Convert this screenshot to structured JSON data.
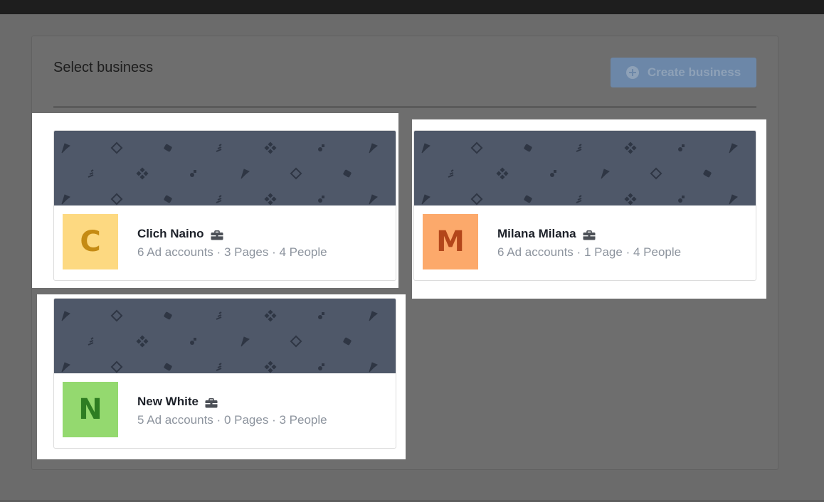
{
  "panel": {
    "title": "Select business",
    "create_button_label": "Create business"
  },
  "colors": {
    "banner": "#4f5869",
    "create_button": "#6c87a8"
  },
  "businesses": [
    {
      "name": "Clich Naino",
      "initial": "C",
      "ad_accounts": "6 Ad accounts",
      "pages": "3 Pages",
      "people": "4 People",
      "avatar_bg": "#fdd981",
      "avatar_fg": "#c58b14"
    },
    {
      "name": "Milana Milana",
      "initial": "M",
      "ad_accounts": "6 Ad accounts",
      "pages": "1 Page",
      "people": "4 People",
      "avatar_bg": "#fca96b",
      "avatar_fg": "#b3461a"
    },
    {
      "name": "New White",
      "initial": "N",
      "ad_accounts": "5 Ad accounts",
      "pages": "0 Pages",
      "people": "3 People",
      "avatar_bg": "#94d96f",
      "avatar_fg": "#2e7d22"
    }
  ],
  "separator": "·"
}
